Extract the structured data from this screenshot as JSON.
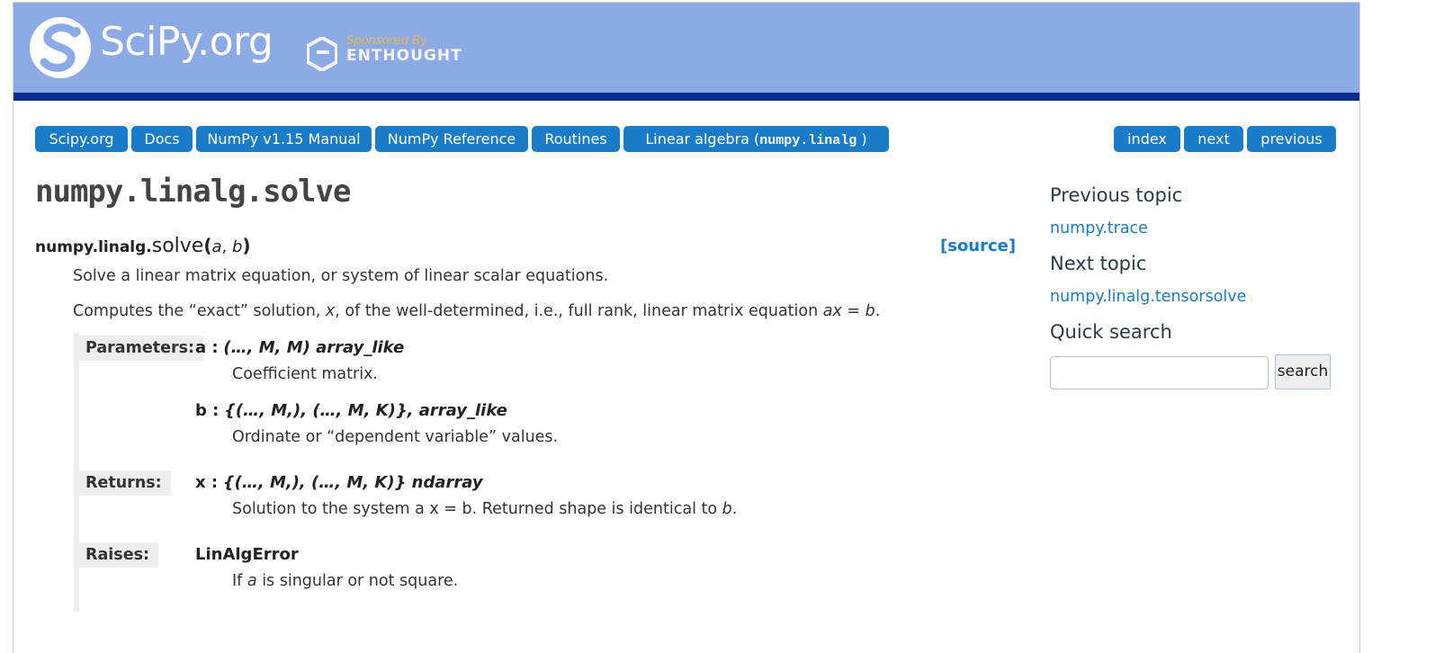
{
  "header": {
    "logo_text": "SciPy.org",
    "sponsor_by": "Sponsored By",
    "sponsor_name": "ENTHOUGHT"
  },
  "breadcrumbs": [
    {
      "label": "Scipy.org"
    },
    {
      "label": "Docs"
    },
    {
      "label": "NumPy v1.15 Manual"
    },
    {
      "label": "NumPy Reference"
    },
    {
      "label": "Routines"
    },
    {
      "label": "Linear algebra (",
      "code": "numpy.linalg",
      "suffix": " )"
    }
  ],
  "related_nav": [
    {
      "label": "index"
    },
    {
      "label": "next"
    },
    {
      "label": "previous"
    }
  ],
  "main": {
    "title": "numpy.linalg.solve",
    "signature": {
      "prefix": "numpy.linalg.",
      "name": "solve",
      "open": "(",
      "arg1": "a",
      "sep": ", ",
      "arg2": "b",
      "close": ")"
    },
    "source_label": "[source]",
    "summary": "Solve a linear matrix equation, or system of linear scalar equations.",
    "extended": {
      "part1": "Computes the “exact” solution, ",
      "var_x": "x",
      "part2": ", of the well-determined, i.e., full rank, linear matrix equation ",
      "equation": "ax = b",
      "part3": "."
    },
    "fields": {
      "parameters_label": "Parameters:",
      "returns_label": "Returns:",
      "raises_label": "Raises:",
      "param_a_name": "a :",
      "param_a_type": "(…, M, M) array_like",
      "param_a_desc": "Coefficient matrix.",
      "param_b_name": "b :",
      "param_b_type": "{(…, M,), (…, M, K)}, array_like",
      "param_b_desc": "Ordinate or “dependent variable” values.",
      "return_x_name": "x :",
      "return_x_type": "{(…, M,), (…, M, K)} ndarray",
      "return_x_desc": "Solution to the system a x = b. Returned shape is identical to ",
      "return_x_desc_var": "b",
      "return_x_desc_end": ".",
      "raise_name": "LinAlgError",
      "raise_desc_start": "If ",
      "raise_desc_var": "a",
      "raise_desc_end": " is singular or not square."
    }
  },
  "sidebar": {
    "prev_heading": "Previous topic",
    "prev_link": "numpy.trace",
    "next_heading": "Next topic",
    "next_link": "numpy.linalg.tensorsolve",
    "search_heading": "Quick search",
    "search_value": "",
    "search_button": "search"
  },
  "colors": {
    "header_bg": "#8caae6",
    "header_rule": "#0b2d8e",
    "nav_button": "#1a7bc9",
    "link": "#1a7bc9"
  }
}
